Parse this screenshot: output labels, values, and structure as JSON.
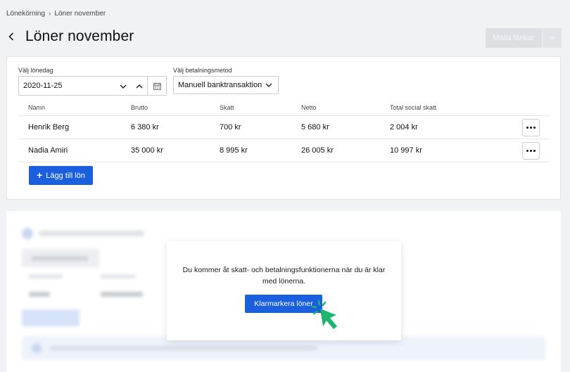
{
  "breadcrumb": {
    "root": "Lönekörning",
    "current": "Löner november"
  },
  "header": {
    "title": "Löner november",
    "mail_button": "Maila länkar"
  },
  "form": {
    "date_label": "Välj lönedag",
    "date_value": "2020-11-25",
    "method_label": "Välj betalningsmetod",
    "method_value": "Manuell banktransaktion"
  },
  "table": {
    "columns": [
      "Namn",
      "Brutto",
      "Skatt",
      "Netto",
      "Total social skatt"
    ],
    "rows": [
      [
        "Henrik Berg",
        "6 380 kr",
        "700 kr",
        "5 680 kr",
        "2 004 kr"
      ],
      [
        "Nadia Amiri",
        "35 000 kr",
        "8 995 kr",
        "26 005 kr",
        "10 997 kr"
      ]
    ]
  },
  "add_button": "Lägg till lön",
  "modal": {
    "text": "Du kommer åt skatt- och betalningsfunktionerna när du är klar med lönerna.",
    "button": "Klarmarkera löner"
  },
  "colors": {
    "primary": "#1a5fdd",
    "cursor": "#1fb56e"
  },
  "icons": [
    "chevron-left-icon",
    "chevron-down-icon",
    "chevron-up-icon",
    "calendar-icon",
    "more-icon",
    "plus-icon",
    "pointer-cursor-icon"
  ]
}
